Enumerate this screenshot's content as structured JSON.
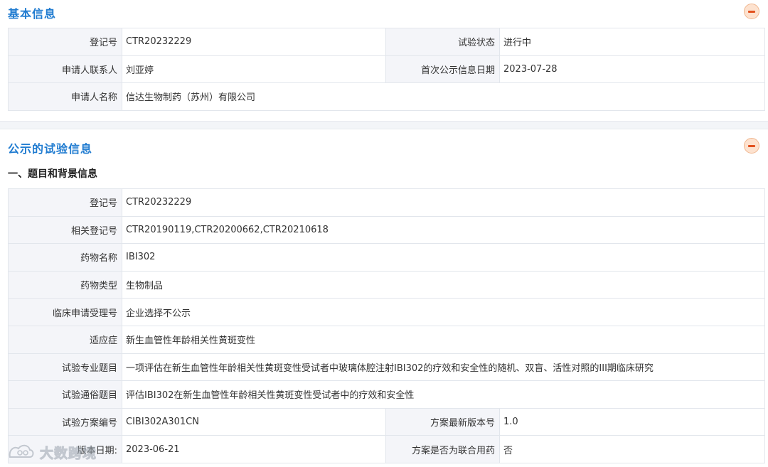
{
  "basic": {
    "title": "基本信息",
    "rows": [
      {
        "l1": "登记号",
        "v1": "CTR20232229",
        "l2": "试验状态",
        "v2": "进行中"
      },
      {
        "l1": "申请人联系人",
        "v1": "刘亚婷",
        "l2": "首次公示信息日期",
        "v2": "2023-07-28"
      }
    ],
    "applicant_label": "申请人名称",
    "applicant_value": "信达生物制药（苏州）有限公司"
  },
  "trial": {
    "title": "公示的试验信息",
    "subhead": "一、题目和背景信息",
    "rows": [
      {
        "label": "登记号",
        "value": "CTR20232229"
      },
      {
        "label": "相关登记号",
        "value": "CTR20190119,CTR20200662,CTR20210618"
      },
      {
        "label": "药物名称",
        "value": "IBI302"
      },
      {
        "label": "药物类型",
        "value": "生物制品"
      },
      {
        "label": "临床申请受理号",
        "value": "企业选择不公示"
      },
      {
        "label": "适应症",
        "value": "新生血管性年龄相关性黄斑变性"
      },
      {
        "label": "试验专业题目",
        "value": "一项评估在新生血管性年龄相关性黄斑变性受试者中玻璃体腔注射IBI302的疗效和安全性的随机、双盲、活性对照的III期临床研究"
      },
      {
        "label": "试验通俗题目",
        "value": "评估IBI302在新生血管性年龄相关性黄斑变性受试者中的疗效和安全性"
      }
    ],
    "pair_rows": [
      {
        "l1": "试验方案编号",
        "v1": "CIBI302A301CN",
        "l2": "方案最新版本号",
        "v2": "1.0"
      },
      {
        "l1": "版本日期:",
        "v1": "2023-06-21",
        "l2": "方案是否为联合用药",
        "v2": "否"
      }
    ]
  },
  "watermark_text": "大数跨境",
  "colors": {
    "title": "#1f7bd0",
    "label_bg": "#f4f5f9",
    "border": "#e2e6ec",
    "collapse": "#e2501e"
  }
}
